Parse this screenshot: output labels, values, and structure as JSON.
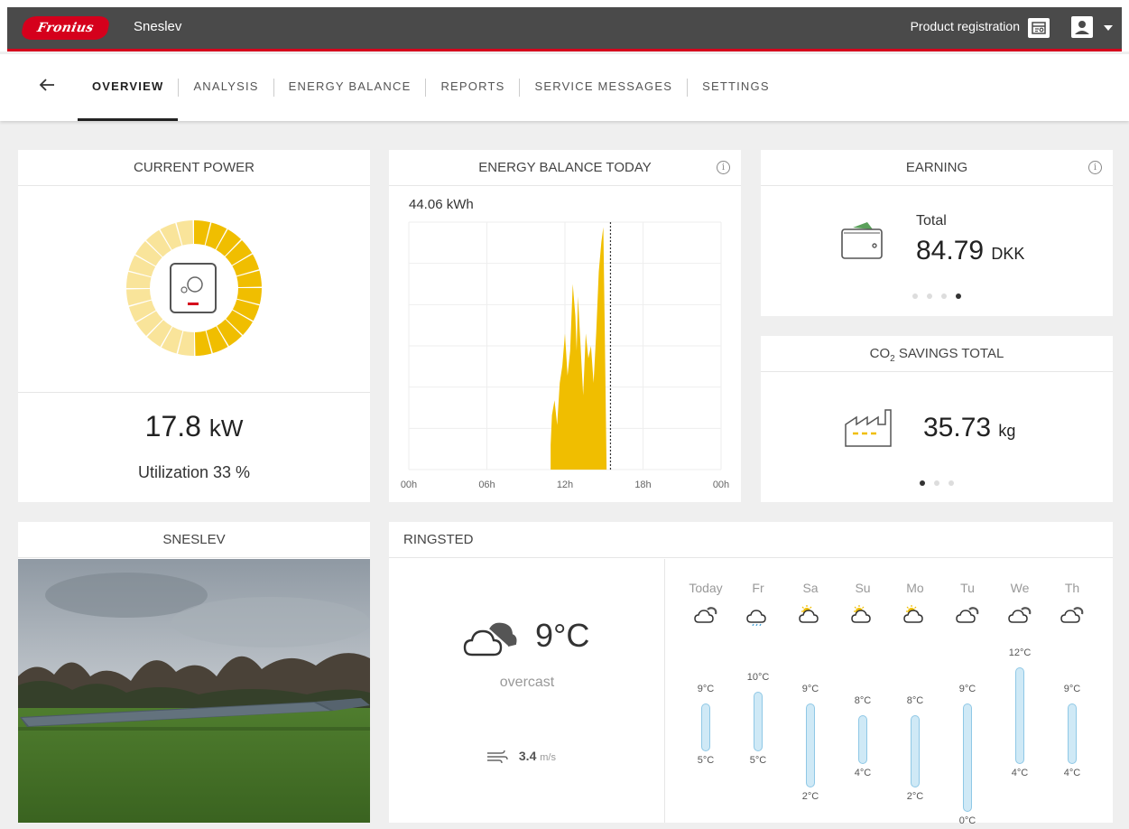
{
  "header": {
    "brand": "Fronius",
    "site_name": "Sneslev",
    "product_registration": "Product registration"
  },
  "nav": {
    "tabs": [
      {
        "label": "OVERVIEW",
        "active": true
      },
      {
        "label": "ANALYSIS",
        "active": false
      },
      {
        "label": "ENERGY BALANCE",
        "active": false
      },
      {
        "label": "REPORTS",
        "active": false
      },
      {
        "label": "SERVICE MESSAGES",
        "active": false
      },
      {
        "label": "SETTINGS",
        "active": false
      }
    ]
  },
  "current_power": {
    "title": "CURRENT POWER",
    "value": "17.8",
    "unit": "kW",
    "utilization": "Utilization 33 %",
    "utilization_fraction": 0.33
  },
  "energy_balance": {
    "title": "ENERGY BALANCE TODAY",
    "total": "44.06 kWh"
  },
  "chart_data": {
    "type": "area",
    "title": "ENERGY BALANCE TODAY",
    "x_tick_labels": [
      "00h",
      "06h",
      "12h",
      "18h",
      "00h"
    ],
    "x_unit": "hour",
    "xlim": [
      0,
      24
    ],
    "x": [
      10.9,
      11.0,
      11.2,
      11.4,
      11.6,
      11.8,
      12.0,
      12.2,
      12.4,
      12.6,
      12.8,
      12.9,
      13.0,
      13.2,
      13.4,
      13.6,
      13.8,
      14.0,
      14.2,
      14.4,
      14.6,
      14.8,
      14.95,
      15.05,
      15.2
    ],
    "y": [
      0.1,
      0.22,
      0.28,
      0.18,
      0.35,
      0.42,
      0.55,
      0.38,
      0.48,
      0.75,
      0.62,
      0.48,
      0.7,
      0.5,
      0.3,
      0.55,
      0.45,
      0.5,
      0.35,
      0.55,
      0.8,
      0.92,
      0.98,
      0.6,
      0.0
    ],
    "ylim": [
      0,
      1
    ],
    "color": "#f0be00",
    "current_time_marker": 15.5,
    "grid": true
  },
  "earning": {
    "title": "EARNING",
    "label": "Total",
    "value": "84.79",
    "unit": "DKK",
    "page_dots": 4,
    "active_dot": 3
  },
  "co2": {
    "title_prefix": "CO",
    "title_sub": "2",
    "title_suffix": " SAVINGS TOTAL",
    "value": "35.73",
    "unit": "kg",
    "page_dots": 3,
    "active_dot": 0
  },
  "site_photo": {
    "title": "SNESLEV"
  },
  "weather": {
    "location": "RINGSTED",
    "current_temp": "9°C",
    "current_desc": "overcast",
    "wind_value": "3.4",
    "wind_unit": "m/s",
    "forecast": [
      {
        "day": "Today",
        "icon": "cloudy-icon",
        "hi": "9°C",
        "lo": "5°C",
        "hi_v": 9,
        "lo_v": 5
      },
      {
        "day": "Fr",
        "icon": "rain-icon",
        "hi": "10°C",
        "lo": "5°C",
        "hi_v": 10,
        "lo_v": 5
      },
      {
        "day": "Sa",
        "icon": "partly-sunny-icon",
        "hi": "9°C",
        "lo": "2°C",
        "hi_v": 9,
        "lo_v": 2
      },
      {
        "day": "Su",
        "icon": "partly-sunny-icon",
        "hi": "8°C",
        "lo": "4°C",
        "hi_v": 8,
        "lo_v": 4
      },
      {
        "day": "Mo",
        "icon": "partly-sunny-icon",
        "hi": "8°C",
        "lo": "2°C",
        "hi_v": 8,
        "lo_v": 2
      },
      {
        "day": "Tu",
        "icon": "cloudy-icon",
        "hi": "9°C",
        "lo": "0°C",
        "hi_v": 9,
        "lo_v": 0
      },
      {
        "day": "We",
        "icon": "cloudy-icon",
        "hi": "12°C",
        "lo": "4°C",
        "hi_v": 12,
        "lo_v": 4
      },
      {
        "day": "Th",
        "icon": "cloudy-icon",
        "hi": "9°C",
        "lo": "4°C",
        "hi_v": 9,
        "lo_v": 4
      }
    ]
  },
  "colors": {
    "brand_red": "#d5001c",
    "header_bg": "#4a4a4a",
    "solar_yellow": "#f0be00",
    "solar_light": "#f9e49a",
    "temp_bar": "#cfe9f6"
  }
}
